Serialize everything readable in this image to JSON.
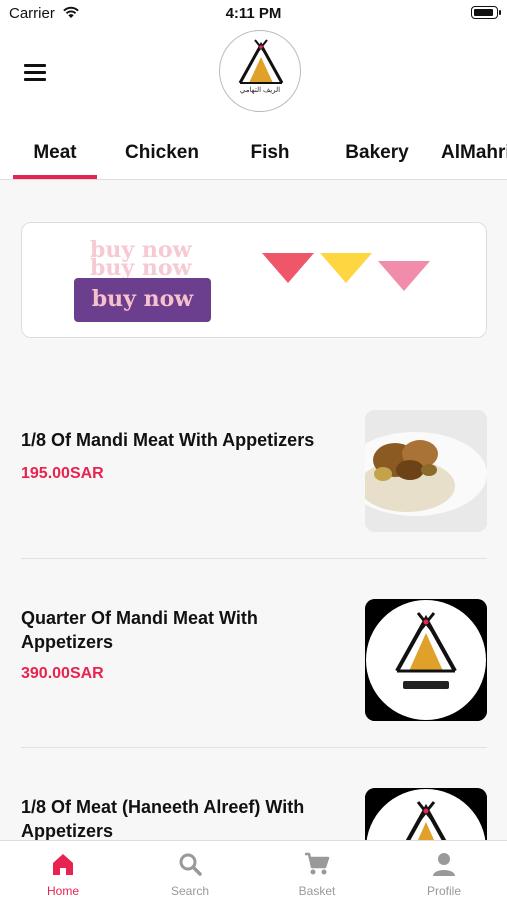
{
  "status_bar": {
    "carrier": "Carrier",
    "time": "4:11 PM"
  },
  "header": {
    "logo_text": "الريف التهامي"
  },
  "tabs": [
    {
      "label": "Meat",
      "active": true
    },
    {
      "label": "Chicken"
    },
    {
      "label": "Fish"
    },
    {
      "label": "Bakery"
    },
    {
      "label": "AlMahri"
    }
  ],
  "banner": {
    "ghost_text_1": "buy now",
    "ghost_text_2": "buy now",
    "button_label": "buy now",
    "triangle_colors": [
      "#f0566a",
      "#fdd642",
      "#f18cab"
    ]
  },
  "products": [
    {
      "name": "1/8 Of Mandi Meat With Appetizers",
      "price": "195.00SAR",
      "image": "mandi-meat-photo"
    },
    {
      "name": "Quarter Of Mandi Meat With Appetizers",
      "price": "390.00SAR",
      "image": "restaurant-logo"
    },
    {
      "name": "1/8 Of Meat (Haneeth Alreef) With Appetizers",
      "price": "",
      "image": "restaurant-logo"
    }
  ],
  "bottom_nav": [
    {
      "label": "Home",
      "icon": "home-icon",
      "active": true
    },
    {
      "label": "Search",
      "icon": "search-icon"
    },
    {
      "label": "Basket",
      "icon": "cart-icon"
    },
    {
      "label": "Profile",
      "icon": "profile-icon"
    }
  ],
  "colors": {
    "accent": "#e8234f",
    "banner_button": "#6b3f8e"
  }
}
